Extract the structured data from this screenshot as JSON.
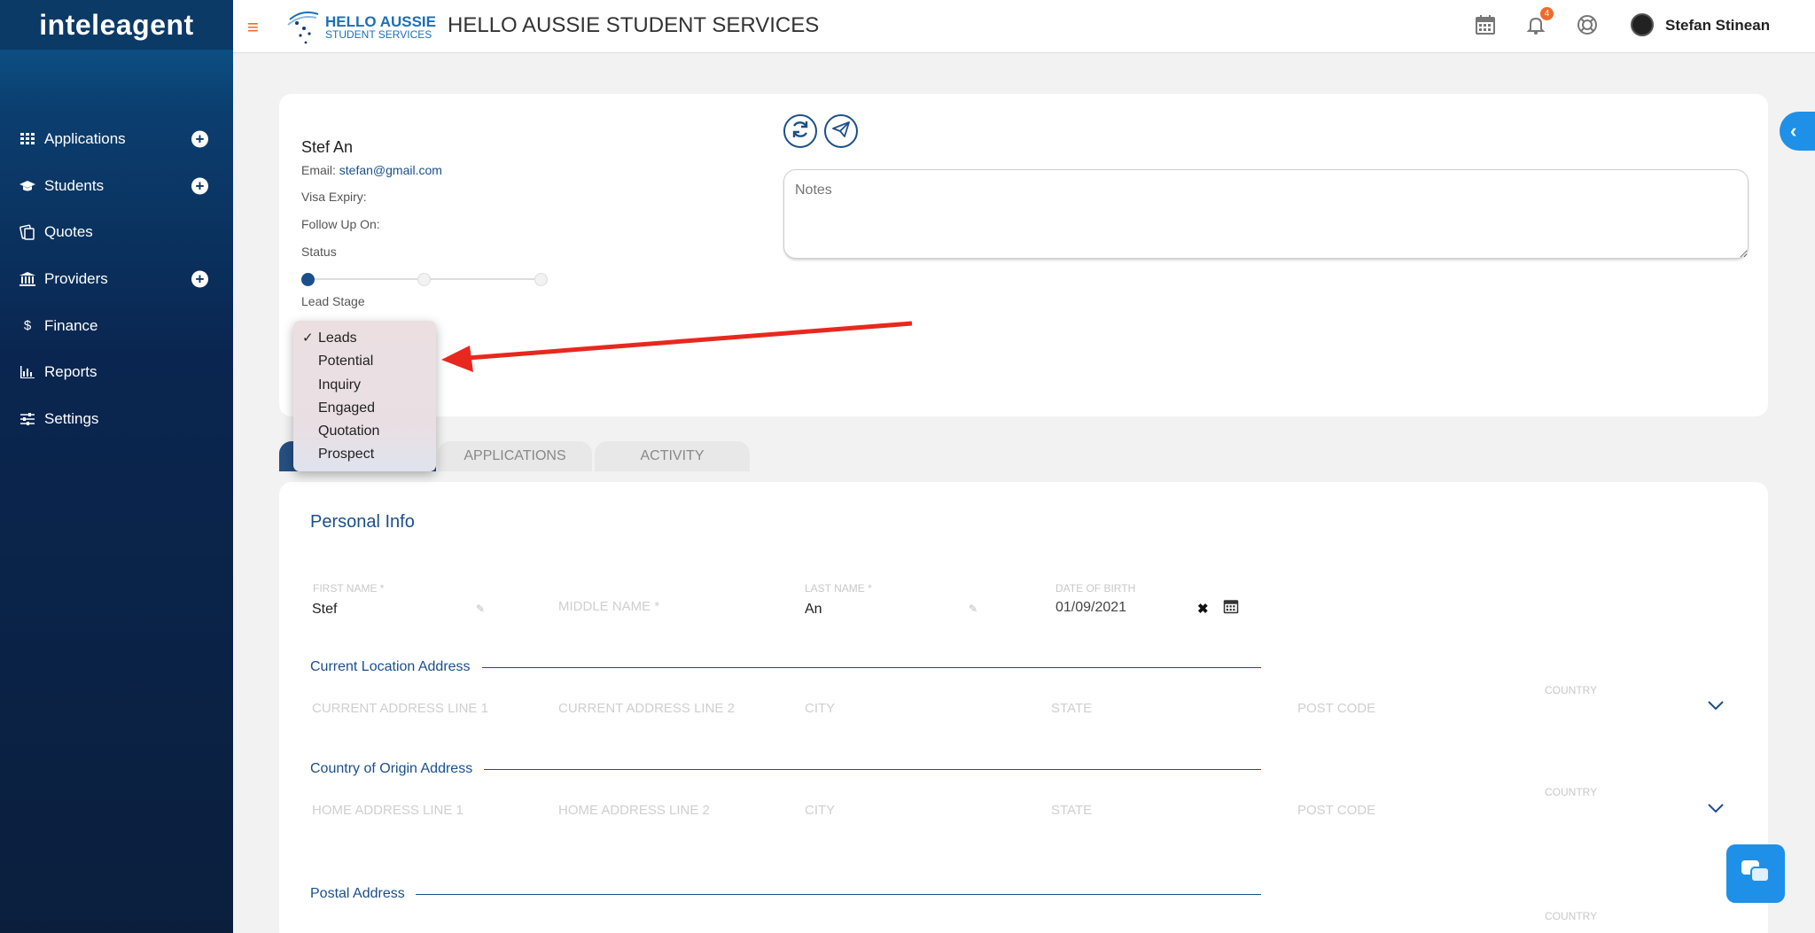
{
  "sidebar": {
    "logo": "inteleagent",
    "items": [
      {
        "label": "Applications",
        "icon": "grid-icon",
        "has_add": true
      },
      {
        "label": "Students",
        "icon": "graduation-cap-icon",
        "has_add": true
      },
      {
        "label": "Quotes",
        "icon": "quotes-icon",
        "has_add": false
      },
      {
        "label": "Providers",
        "icon": "institution-icon",
        "has_add": true
      },
      {
        "label": "Finance",
        "icon": "dollar-icon",
        "has_add": false
      },
      {
        "label": "Reports",
        "icon": "bar-chart-icon",
        "has_add": false
      },
      {
        "label": "Settings",
        "icon": "sliders-icon",
        "has_add": false
      }
    ]
  },
  "header": {
    "brand_line1": "HELLO AUSSIE",
    "brand_line2": "STUDENT SERVICES",
    "title": "HELLO AUSSIE STUDENT SERVICES",
    "notification_count": "4",
    "user_name": "Stefan Stinean"
  },
  "student": {
    "name": "Stef An",
    "email_label": "Email:",
    "email": "stefan@gmail.com",
    "visa_label": "Visa Expiry:",
    "follow_up_label": "Follow Up On:",
    "status_label": "Status",
    "lead_stage_label": "Lead Stage",
    "notes_placeholder": "Notes"
  },
  "lead_stage_dropdown": {
    "selected": "Leads",
    "options": [
      "Leads",
      "Potential",
      "Inquiry",
      "Engaged",
      "Quotation",
      "Prospect"
    ]
  },
  "tabs": [
    {
      "label": "",
      "active": true
    },
    {
      "label": "APPLICATIONS",
      "active": false
    },
    {
      "label": "ACTIVITY",
      "active": false
    }
  ],
  "personal_info": {
    "title": "Personal Info",
    "first_name_label": "FIRST NAME *",
    "first_name": "Stef",
    "middle_name_placeholder": "MIDDLE NAME *",
    "last_name_label": "LAST NAME *",
    "last_name": "An",
    "dob_label": "DATE OF BIRTH",
    "dob": "01/09/2021"
  },
  "current_address": {
    "title": "Current Location Address",
    "line1": "CURRENT ADDRESS LINE 1",
    "line2": "CURRENT ADDRESS LINE 2",
    "city": "CITY",
    "state": "STATE",
    "post_code": "POST CODE",
    "country_label": "COUNTRY"
  },
  "origin_address": {
    "title": "Country of Origin Address",
    "line1": "HOME ADDRESS LINE 1",
    "line2": "HOME ADDRESS LINE 2",
    "city": "CITY",
    "state": "STATE",
    "post_code": "POST CODE",
    "country_label": "COUNTRY"
  },
  "postal_address": {
    "title": "Postal Address",
    "country_label": "COUNTRY"
  },
  "colors": {
    "sidebar": "#0b2a55",
    "accent": "#1a4f8b",
    "orange": "#ef6a2c",
    "annotation_arrow": "#e8281e",
    "chat_button": "#1e90e8"
  }
}
